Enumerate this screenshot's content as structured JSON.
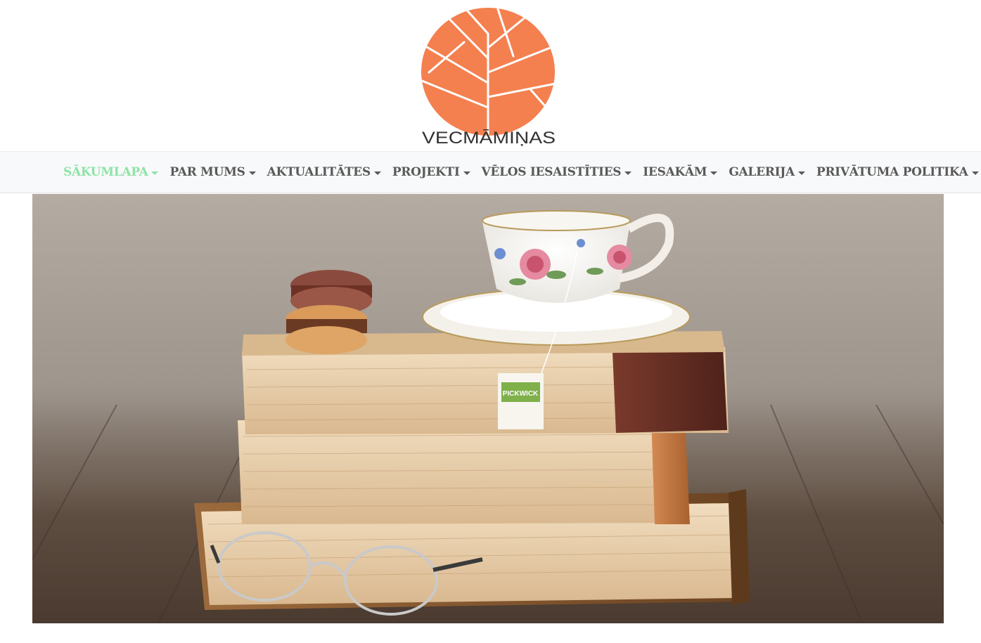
{
  "brand": {
    "name": "VECMĀMIŅAS",
    "logo_color": "#f4804f"
  },
  "nav": {
    "active_color": "#8fe3a6",
    "items": [
      {
        "label": "SĀKUMLAPA",
        "active": true
      },
      {
        "label": "PAR MUMS",
        "active": false
      },
      {
        "label": "AKTUALITĀTES",
        "active": false
      },
      {
        "label": "PROJEKTI",
        "active": false
      },
      {
        "label": "VĒLOS IESAISTĪTIES",
        "active": false
      },
      {
        "label": "IESAKĀM",
        "active": false
      },
      {
        "label": "GALERIJA",
        "active": false
      },
      {
        "label": "PRIVĀTUMA POLITIKA",
        "active": false
      }
    ]
  },
  "hero": {
    "tea_tag_text": "PICKWICK"
  }
}
